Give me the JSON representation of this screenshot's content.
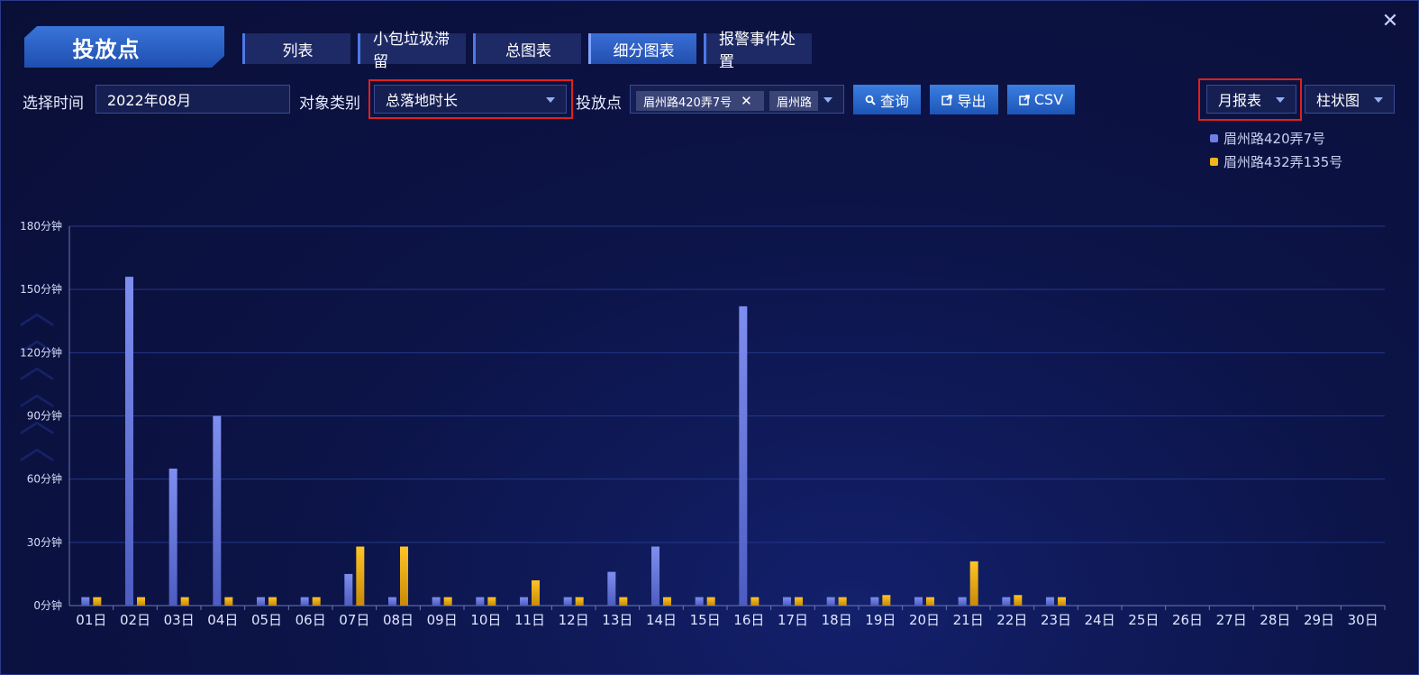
{
  "window": {
    "close_label": "✕"
  },
  "title_tab": "投放点",
  "tabs": [
    {
      "label": "列表",
      "active": false
    },
    {
      "label": "小包垃圾滞留",
      "active": false
    },
    {
      "label": "总图表",
      "active": false
    },
    {
      "label": "细分图表",
      "active": true
    },
    {
      "label": "报警事件处置",
      "active": false
    }
  ],
  "filters": {
    "time_label": "选择时间",
    "time_value": "2022年08月",
    "type_label": "对象类别",
    "type_value": "总落地时长",
    "point_label": "投放点",
    "point_chips": [
      "眉州路420弄7号",
      "眉州路"
    ],
    "query_label": "查询",
    "export_label": "导出",
    "csv_label": "CSV",
    "report_value": "月报表",
    "chart_type_value": "柱状图"
  },
  "colors": {
    "series1": "#6f7fe6",
    "series2": "#f2b51a",
    "accent": "#3b7fe0",
    "highlight": "#e02020"
  },
  "icons": {
    "close": "close-icon",
    "search": "search-icon",
    "export": "export-icon",
    "csv": "export-icon",
    "caret": "caret-down-icon"
  },
  "chart_data": {
    "type": "bar",
    "categories": [
      "01日",
      "02日",
      "03日",
      "04日",
      "05日",
      "06日",
      "07日",
      "08日",
      "09日",
      "10日",
      "11日",
      "12日",
      "13日",
      "14日",
      "15日",
      "16日",
      "17日",
      "18日",
      "19日",
      "20日",
      "21日",
      "22日",
      "23日",
      "24日",
      "25日",
      "26日",
      "27日",
      "28日",
      "29日",
      "30日"
    ],
    "series": [
      {
        "name": "眉州路420弄7号",
        "values": [
          4,
          156,
          65,
          90,
          4,
          4,
          15,
          4,
          4,
          4,
          4,
          4,
          16,
          28,
          4,
          142,
          4,
          4,
          4,
          4,
          4,
          4,
          4,
          0,
          0,
          0,
          0,
          0,
          0,
          0
        ]
      },
      {
        "name": "眉州路432弄135号",
        "values": [
          4,
          4,
          4,
          4,
          4,
          4,
          28,
          28,
          4,
          4,
          12,
          4,
          4,
          4,
          4,
          4,
          4,
          4,
          5,
          4,
          21,
          5,
          4,
          0,
          0,
          0,
          0,
          0,
          0,
          0
        ]
      }
    ],
    "yticks": [
      "0分钟",
      "30分钟",
      "60分钟",
      "90分钟",
      "120分钟",
      "150分钟",
      "180分钟"
    ],
    "ylim": [
      0,
      180
    ],
    "grid": true,
    "legend_position": "top-right"
  }
}
